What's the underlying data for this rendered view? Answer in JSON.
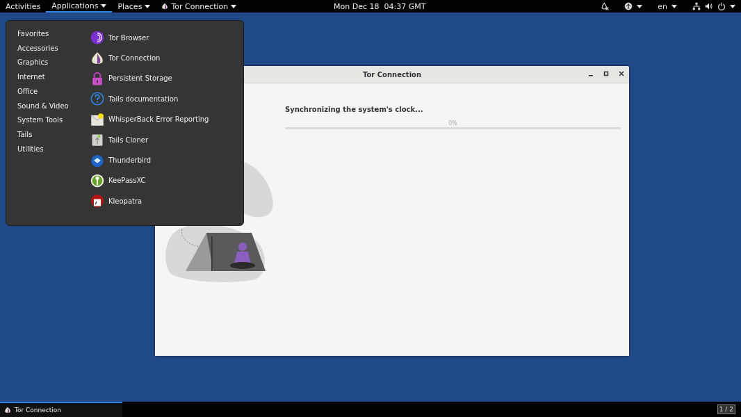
{
  "top_bar": {
    "activities": "Activities",
    "menus": [
      {
        "label": "Applications",
        "selected": true,
        "kind": "plain"
      },
      {
        "label": "Places",
        "selected": false,
        "kind": "plain"
      },
      {
        "label": "Tor Connection",
        "selected": false,
        "kind": "app"
      }
    ],
    "clock": "Mon Dec 18  04:37 GMT",
    "language": "en"
  },
  "app_menu": {
    "categories": [
      "Favorites",
      "Accessories",
      "Graphics",
      "Internet",
      "Office",
      "Sound & Video",
      "System Tools",
      "Tails",
      "Utilities"
    ],
    "apps": [
      {
        "label": "Tor Browser",
        "kind": "browser"
      },
      {
        "label": "Tor Connection",
        "kind": "onion"
      },
      {
        "label": "Persistent Storage",
        "kind": "lock"
      },
      {
        "label": "Tails documentation",
        "kind": "help"
      },
      {
        "label": "WhisperBack Error Reporting",
        "kind": "mail"
      },
      {
        "label": "Tails Cloner",
        "kind": "drive"
      },
      {
        "label": "Thunderbird",
        "kind": "bird"
      },
      {
        "label": "KeePassXC",
        "kind": "key"
      },
      {
        "label": "Kleopatra",
        "kind": "cert"
      }
    ]
  },
  "window": {
    "title": "Tor Connection",
    "status": "Synchronizing the system's clock...",
    "progress": {
      "level": 0,
      "reading": "0%"
    }
  },
  "taskbar": {
    "items": [
      {
        "label": "Tor Connection",
        "selected": true
      }
    ],
    "workspace": "1 / 2"
  }
}
